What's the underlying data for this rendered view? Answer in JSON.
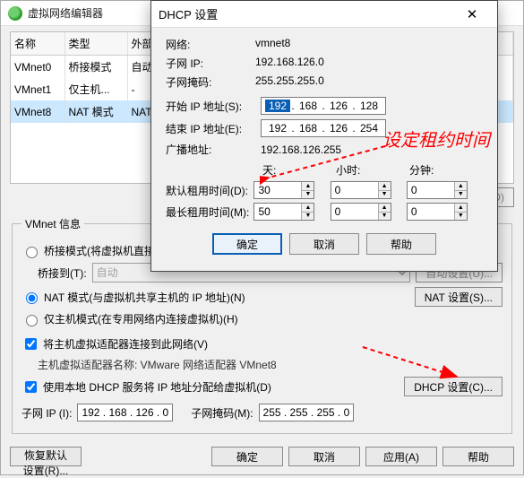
{
  "main": {
    "title": "虚拟网络编辑器",
    "table": {
      "headers": [
        "名称",
        "类型",
        "外部",
        "…"
      ],
      "rows": [
        {
          "name": "VMnet0",
          "type": "桥接模式",
          "ext": "自动桥"
        },
        {
          "name": "VMnet1",
          "type": "仅主机...",
          "ext": "-"
        },
        {
          "name": "VMnet8",
          "type": "NAT 模式",
          "ext": "NAT 桥",
          "selected": true
        }
      ]
    },
    "vmnet_legend": "VMnet 信息",
    "radio_bridge": "桥接模式(将虚拟机直接连...",
    "bridge_to_label": "桥接到(T):",
    "bridge_to_value": "自动",
    "auto_settings_btn": "自动设置(U)...",
    "radio_nat": "NAT 模式(与虚拟机共享主机的 IP 地址)(N)",
    "nat_settings_btn": "NAT 设置(S)...",
    "radio_hostonly": "仅主机模式(在专用网络内连接虚拟机)(H)",
    "chk_host_adapter": "将主机虚拟适配器连接到此网络(V)",
    "host_adapter_name_label": "主机虚拟适配器名称: VMware 网络适配器 VMnet8",
    "chk_dhcp": "使用本地 DHCP 服务将 IP 地址分配给虚拟机(D)",
    "dhcp_settings_btn": "DHCP 设置(C)...",
    "subnet_ip_label": "子网 IP (I):",
    "subnet_ip_value": "192 . 168 . 126 .   0",
    "subnet_mask_label": "子网掩码(M):",
    "subnet_mask_value": "255 . 255 . 255 .   0",
    "restore_btn": "恢复默认设置(R)...",
    "ok_btn": "确定",
    "cancel_btn": "取消",
    "apply_btn": "应用(A)",
    "help_btn": "帮助",
    "nat_dhcp_btn_right": "(O)"
  },
  "dlg": {
    "title": "DHCP 设置",
    "network_label": "网络:",
    "network_value": "vmnet8",
    "subnet_ip_label": "子网 IP:",
    "subnet_ip_value": "192.168.126.0",
    "subnet_mask_label": "子网掩码:",
    "subnet_mask_value": "255.255.255.0",
    "start_ip_label": "开始 IP 地址(S):",
    "start_ip": [
      "192",
      "168",
      "126",
      "128"
    ],
    "end_ip_label": "结束 IP 地址(E):",
    "end_ip": [
      "192",
      "168",
      "126",
      "254"
    ],
    "broadcast_label": "广播地址:",
    "broadcast_value": "192.168.126.255",
    "col_days": "天:",
    "col_hours": "小时:",
    "col_minutes": "分钟:",
    "default_lease_label": "默认租用时间(D):",
    "default_lease": {
      "days": "30",
      "hours": "0",
      "minutes": "0"
    },
    "max_lease_label": "最长租用时间(M):",
    "max_lease": {
      "days": "50",
      "hours": "0",
      "minutes": "0"
    },
    "ok": "确定",
    "cancel": "取消",
    "help": "帮助"
  },
  "annotation": {
    "text": "设定租约时间"
  }
}
